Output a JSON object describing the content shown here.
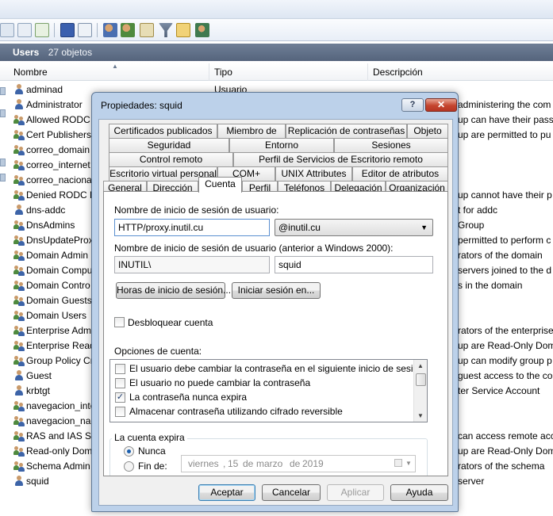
{
  "console": {
    "header_title": "Users",
    "header_count": "27 objetos",
    "columns": [
      "Nombre",
      "Tipo",
      "Descripción"
    ],
    "rows": [
      {
        "name": "adminad",
        "type": "Usuario",
        "desc": "",
        "icon": "user-icon"
      },
      {
        "name": "Administrator",
        "type": "",
        "desc": "administering the com",
        "icon": "user-icon"
      },
      {
        "name": "Allowed RODC",
        "type": "",
        "desc": "up can have their passw",
        "icon": "group-icon"
      },
      {
        "name": "Cert Publishers",
        "type": "",
        "desc": "up are permitted to pu",
        "icon": "group-icon"
      },
      {
        "name": "correo_domain",
        "type": "",
        "desc": "",
        "icon": "group-icon"
      },
      {
        "name": "correo_internet",
        "type": "",
        "desc": "",
        "icon": "group-icon"
      },
      {
        "name": "correo_naciona",
        "type": "",
        "desc": "",
        "icon": "group-icon"
      },
      {
        "name": "Denied RODC P",
        "type": "",
        "desc": "up cannot have their p",
        "icon": "group-icon"
      },
      {
        "name": "dns-addc",
        "type": "",
        "desc": "t for addc",
        "icon": "user-icon"
      },
      {
        "name": "DnsAdmins",
        "type": "",
        "desc": "Group",
        "icon": "group-icon"
      },
      {
        "name": "DnsUpdateProx",
        "type": "",
        "desc": "permitted to perform c",
        "icon": "group-icon"
      },
      {
        "name": "Domain Admin",
        "type": "",
        "desc": "rators of the domain",
        "icon": "group-icon"
      },
      {
        "name": "Domain Compu",
        "type": "",
        "desc": "servers joined to the d",
        "icon": "group-icon"
      },
      {
        "name": "Domain Contro",
        "type": "",
        "desc": "s in the domain",
        "icon": "group-icon"
      },
      {
        "name": "Domain Guests",
        "type": "",
        "desc": "",
        "icon": "group-icon"
      },
      {
        "name": "Domain Users",
        "type": "",
        "desc": "",
        "icon": "group-icon"
      },
      {
        "name": "Enterprise Adm",
        "type": "",
        "desc": "rators of the enterprise",
        "icon": "group-icon"
      },
      {
        "name": "Enterprise Read",
        "type": "",
        "desc": "up are Read-Only Dom",
        "icon": "group-icon"
      },
      {
        "name": "Group Policy Cr",
        "type": "",
        "desc": "up can modify group p",
        "icon": "group-icon"
      },
      {
        "name": "Guest",
        "type": "",
        "desc": "guest access to the cor",
        "icon": "user-icon"
      },
      {
        "name": "krbtgt",
        "type": "",
        "desc": "ter Service Account",
        "icon": "user-icon"
      },
      {
        "name": "navegacion_inte",
        "type": "",
        "desc": "",
        "icon": "group-icon"
      },
      {
        "name": "navegacion_nac",
        "type": "",
        "desc": "",
        "icon": "group-icon"
      },
      {
        "name": "RAS and IAS Ser",
        "type": "",
        "desc": "can access remote acc",
        "icon": "group-icon"
      },
      {
        "name": "Read-only Dom",
        "type": "",
        "desc": "up are Read-Only Dom",
        "icon": "group-icon"
      },
      {
        "name": "Schema Admin",
        "type": "",
        "desc": "rators of the schema",
        "icon": "group-icon"
      },
      {
        "name": "squid",
        "type": "",
        "desc": "server",
        "icon": "user-icon"
      }
    ]
  },
  "dialog": {
    "title": "Propiedades: squid",
    "help_label": "?",
    "close_label": "✕",
    "tabs_row1": [
      "Certificados publicados",
      "Miembro de",
      "Replicación de contraseñas",
      "Objeto"
    ],
    "tabs_row2": [
      "Seguridad",
      "Entorno",
      "Sesiones"
    ],
    "tabs_row3": [
      "Control remoto",
      "Perfil de Servicios de Escritorio remoto"
    ],
    "tabs_row4": [
      "Escritorio virtual personal",
      "COM+",
      "UNIX Attributes",
      "Editor de atributos"
    ],
    "tabs_row5": [
      "General",
      "Dirección",
      "Cuenta",
      "Perfil",
      "Teléfonos",
      "Delegación",
      "Organización"
    ],
    "active_tab": "Cuenta",
    "logon_name_label": "Nombre de inicio de sesión de usuario:",
    "logon_name_value": "HTTP/proxy.inutil.cu",
    "domain_suffix": "@inutil.cu",
    "pre2000_label": "Nombre de inicio de sesión de usuario (anterior a Windows 2000):",
    "pre2000_domain": "INUTIL\\",
    "pre2000_user": "squid",
    "logon_hours_button": "Horas de inicio de sesión...",
    "logon_to_button": "Iniciar sesión en...",
    "unlock_label": "Desbloquear cuenta",
    "unlock_checked": false,
    "account_options_label": "Opciones de cuenta:",
    "account_options": [
      {
        "label": "El usuario debe cambiar la contraseña en el siguiente inicio de sesión",
        "checked": false
      },
      {
        "label": "El usuario no puede cambiar la contraseña",
        "checked": false
      },
      {
        "label": "La contraseña nunca expira",
        "checked": true
      },
      {
        "label": "Almacenar contraseña utilizando cifrado reversible",
        "checked": false
      }
    ],
    "expires_group_label": "La cuenta expira",
    "never_label": "Nunca",
    "end_label": "Fin de:",
    "expires_selected": "Nunca",
    "date": {
      "weekday": "viernes",
      "day": "15",
      "de1": "de",
      "month": "marzo",
      "de2": "de",
      "year": "2019"
    },
    "ok_button": "Aceptar",
    "cancel_button": "Cancelar",
    "apply_button": "Aplicar",
    "help_button": "Ayuda"
  },
  "colors": {
    "header_bg": "#5d6d86",
    "dialog_frame": "#bcd1ea",
    "close_red": "#c5452f",
    "check_mark": "#1c3b6e"
  }
}
